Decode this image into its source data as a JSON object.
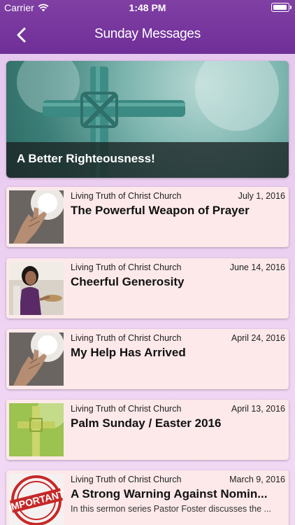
{
  "status_bar": {
    "carrier": "Carrier",
    "time": "1:48 PM"
  },
  "nav": {
    "title": "Sunday Messages",
    "back_icon": "chevron-left-icon"
  },
  "featured": {
    "title": "A Better Righteousness!"
  },
  "messages": [
    {
      "church": "Living Truth of Christ Church",
      "date": "July 1, 2016",
      "title": "The Powerful Weapon of Prayer",
      "thumbnail": "hand-icon"
    },
    {
      "church": "Living Truth of Christ Church",
      "date": "June 14, 2016",
      "title": "Cheerful Generosity",
      "thumbnail": "offering-icon"
    },
    {
      "church": "Living Truth of Christ Church",
      "date": "April 24, 2016",
      "title": "My Help Has Arrived",
      "thumbnail": "hand-icon"
    },
    {
      "church": "Living Truth of Christ Church",
      "date": "April 13, 2016",
      "title": "Palm Sunday / Easter 2016",
      "thumbnail": "palm-cross-icon"
    },
    {
      "church": "Living Truth of Christ Church",
      "date": "March 9, 2016",
      "title": "A Strong Warning Against Nomin...",
      "description": "In this sermon series Pastor Foster discusses the ...",
      "thumbnail": "important-stamp-icon",
      "stamp_text": "IMPORTANT"
    }
  ],
  "colors": {
    "nav": "#7a3aa0",
    "card": "#fde9ea",
    "background": "#e6c8ee"
  }
}
